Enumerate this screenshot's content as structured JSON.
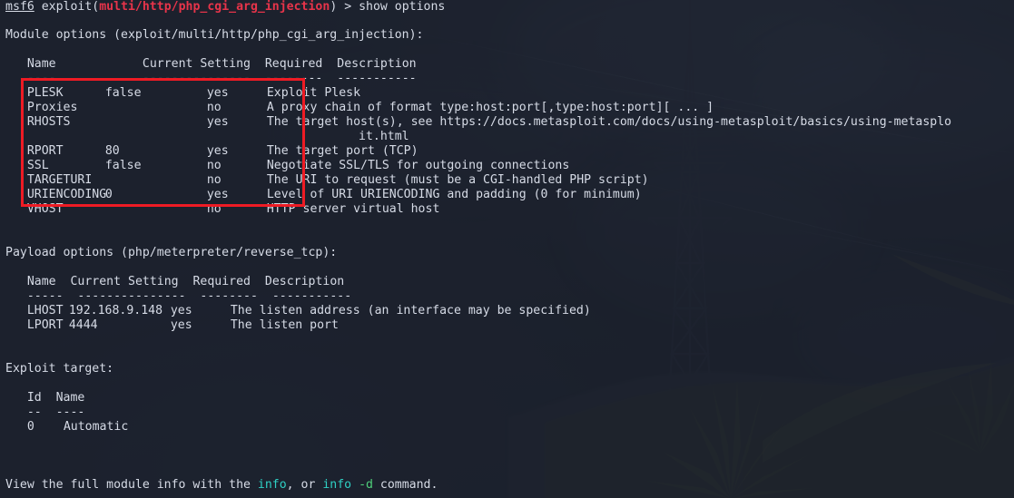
{
  "terminal": {
    "prompt_prefix": "msf6",
    "prompt_command_start": " exploit(",
    "module_path": "multi/http/php_cgi_arg_injection",
    "prompt_command_end": ") > show options",
    "module_options_header": "Module options (exploit/multi/http/php_cgi_arg_injection):",
    "payload_options_header": "Payload options (php/meterpreter/reverse_tcp):",
    "exploit_target_header": "Exploit target:",
    "footer": {
      "part1": "View the full module info with the ",
      "info1": "info",
      "part2": ", or ",
      "info2": "info",
      "part3": " ",
      "flag": "-d",
      "part4": " command."
    },
    "columns": {
      "name": "Name",
      "current_setting": "Current Setting",
      "required": "Required",
      "description": "Description"
    },
    "module_rules": {
      "name": "----",
      "current_setting": "---------------",
      "required": "--------",
      "description": "-----------"
    },
    "payload_rules": {
      "name": "-----",
      "current_setting": "---------------",
      "required": "--------",
      "description": "-----------"
    },
    "target_columns": {
      "id": "Id",
      "name": "Name"
    },
    "target_rules": {
      "id": "--",
      "name": "----"
    },
    "module_options": [
      {
        "name": "PLESK",
        "current": "false",
        "required": "yes",
        "description": "Exploit Plesk"
      },
      {
        "name": "Proxies",
        "current": "",
        "required": "no",
        "description": "A proxy chain of format type:host:port[,type:host:port][ ... ]"
      },
      {
        "name": "RHOSTS",
        "current": "",
        "required": "yes",
        "description": "The target host(s), see https://docs.metasploit.com/docs/using-metasploit/basics/using-metasplo"
      },
      {
        "name": "",
        "current": "",
        "required": "",
        "description": "it.html"
      },
      {
        "name": "RPORT",
        "current": "80",
        "required": "yes",
        "description": "The target port (TCP)"
      },
      {
        "name": "SSL",
        "current": "false",
        "required": "no",
        "description": "Negotiate SSL/TLS for outgoing connections"
      },
      {
        "name": "TARGETURI",
        "current": "",
        "required": "no",
        "description": "The URI to request (must be a CGI-handled PHP script)"
      },
      {
        "name": "URIENCODING",
        "current": "0",
        "required": "yes",
        "description": "Level of URI URIENCODING and padding (0 for minimum)"
      },
      {
        "name": "VHOST",
        "current": "",
        "required": "no",
        "description": "HTTP server virtual host"
      }
    ],
    "payload_options": [
      {
        "name": "LHOST",
        "current": "192.168.9.148",
        "required": "yes",
        "description": "The listen address (an interface may be specified)"
      },
      {
        "name": "LPORT",
        "current": "4444",
        "required": "yes",
        "description": "The listen port"
      }
    ],
    "exploit_targets": [
      {
        "id": "0",
        "name": "Automatic"
      }
    ]
  },
  "annotation": {
    "color": "#ee1b24",
    "label": "module-options-highlight"
  }
}
